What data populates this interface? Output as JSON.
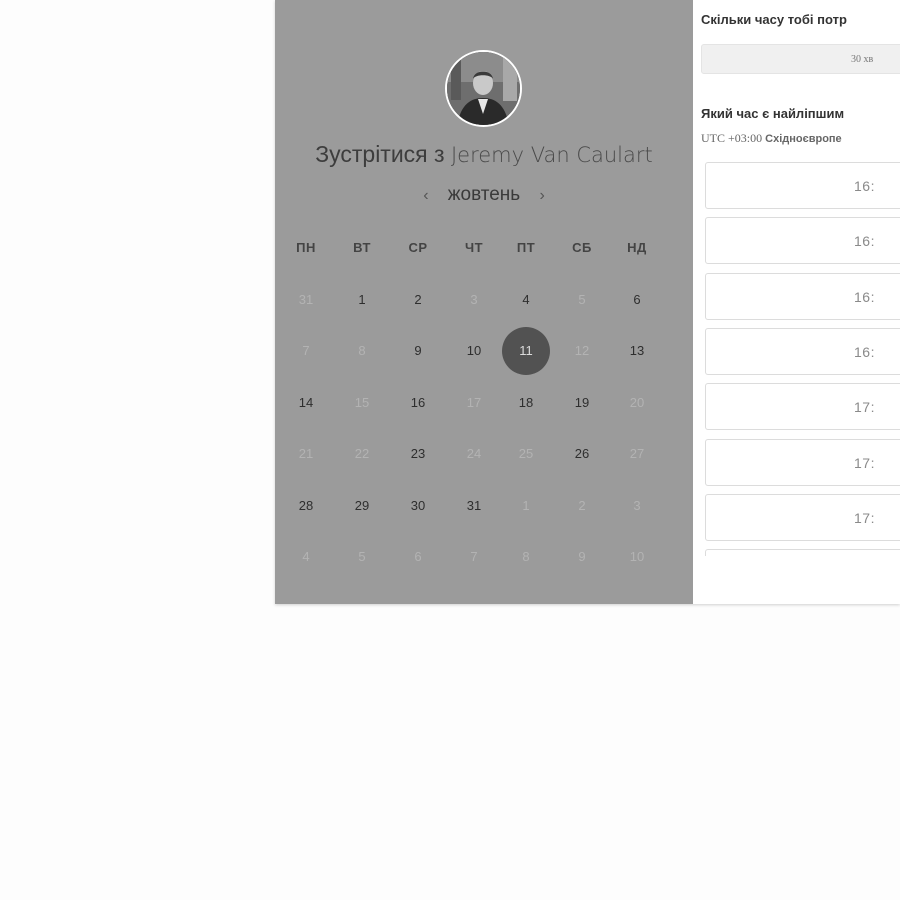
{
  "host": {
    "title_prefix": "Зустрітися з",
    "name": "Jeremy Van Caulart"
  },
  "calendar": {
    "month": "жовтень",
    "prev_icon": "‹",
    "next_icon": "›",
    "weekdays": [
      "ПН",
      "ВТ",
      "СР",
      "ЧТ",
      "ПТ",
      "СБ",
      "НД"
    ],
    "selected_day": "11",
    "weeks": [
      [
        {
          "d": "31",
          "s": "dim"
        },
        {
          "d": "1",
          "s": "avail"
        },
        {
          "d": "2",
          "s": "avail"
        },
        {
          "d": "3",
          "s": "dim"
        },
        {
          "d": "4",
          "s": "avail"
        },
        {
          "d": "5",
          "s": "dim"
        },
        {
          "d": "6",
          "s": "avail"
        }
      ],
      [
        {
          "d": "7",
          "s": "dim"
        },
        {
          "d": "8",
          "s": "dim"
        },
        {
          "d": "9",
          "s": "avail"
        },
        {
          "d": "10",
          "s": "avail"
        },
        {
          "d": "11",
          "s": "sel"
        },
        {
          "d": "12",
          "s": "dim"
        },
        {
          "d": "13",
          "s": "avail"
        }
      ],
      [
        {
          "d": "14",
          "s": "avail"
        },
        {
          "d": "15",
          "s": "dim"
        },
        {
          "d": "16",
          "s": "avail"
        },
        {
          "d": "17",
          "s": "dim"
        },
        {
          "d": "18",
          "s": "avail"
        },
        {
          "d": "19",
          "s": "avail"
        },
        {
          "d": "20",
          "s": "dim"
        }
      ],
      [
        {
          "d": "21",
          "s": "dim"
        },
        {
          "d": "22",
          "s": "dim"
        },
        {
          "d": "23",
          "s": "avail"
        },
        {
          "d": "24",
          "s": "dim"
        },
        {
          "d": "25",
          "s": "dim"
        },
        {
          "d": "26",
          "s": "avail"
        },
        {
          "d": "27",
          "s": "dim"
        }
      ],
      [
        {
          "d": "28",
          "s": "avail"
        },
        {
          "d": "29",
          "s": "avail"
        },
        {
          "d": "30",
          "s": "avail"
        },
        {
          "d": "31",
          "s": "avail"
        },
        {
          "d": "1",
          "s": "dim"
        },
        {
          "d": "2",
          "s": "dim"
        },
        {
          "d": "3",
          "s": "dim"
        }
      ],
      [
        {
          "d": "4",
          "s": "dim"
        },
        {
          "d": "5",
          "s": "dim"
        },
        {
          "d": "6",
          "s": "dim"
        },
        {
          "d": "7",
          "s": "dim"
        },
        {
          "d": "8",
          "s": "dim"
        },
        {
          "d": "9",
          "s": "dim"
        },
        {
          "d": "10",
          "s": "dim"
        }
      ]
    ]
  },
  "duration": {
    "question": "Скільки часу тобі потр",
    "value": "30 хв"
  },
  "timeslots": {
    "question": "Який час є найліпшим",
    "tz_offset": "UTC +03:00",
    "tz_name": "Східноєвропе",
    "slots": [
      "16:",
      "16:",
      "16:",
      "16:",
      "17:",
      "17:",
      "17:",
      ""
    ]
  },
  "colors": {
    "panel": "#9b9b9b",
    "selected": "#525252"
  }
}
